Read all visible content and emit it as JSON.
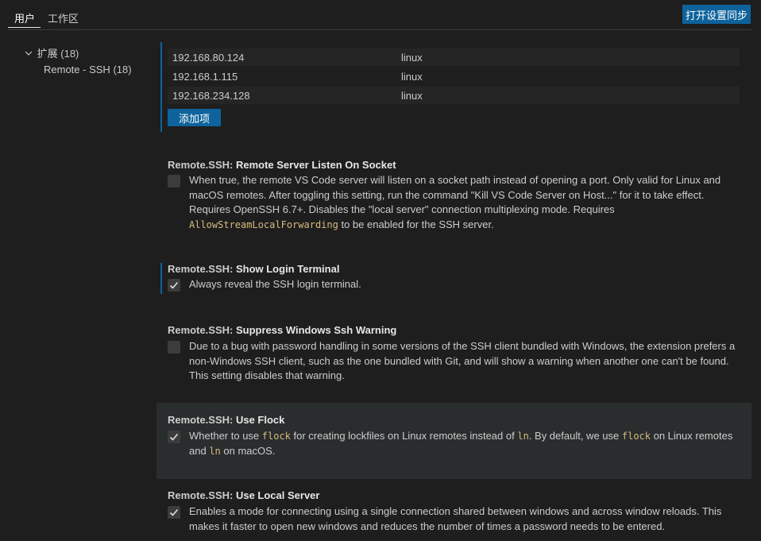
{
  "header": {
    "tabs": [
      {
        "label": "用户",
        "active": true
      },
      {
        "label": "工作区",
        "active": false
      }
    ],
    "sync_button": "打开设置同步"
  },
  "tree": {
    "extensions": {
      "label": "扩展",
      "count": "(18)"
    },
    "remote_ssh": {
      "label": "Remote - SSH",
      "count": "(18)"
    }
  },
  "hosts": {
    "rows": [
      {
        "host": "192.168.80.124",
        "platform": "linux"
      },
      {
        "host": "192.168.1.115",
        "platform": "linux"
      },
      {
        "host": "192.168.234.128",
        "platform": "linux"
      }
    ],
    "add_button": "添加项"
  },
  "settings": [
    {
      "prefix": "Remote.SSH: ",
      "name": "Remote Server Listen On Socket",
      "checked": false,
      "desc_a": "When true, the remote VS Code server will listen on a socket path instead of opening a port. Only valid for Linux and macOS remotes. After toggling this setting, run the command \"Kill VS Code Server on Host...\" for it to take effect. Requires OpenSSH 6.7+. Disables the \"local server\" connection multiplexing mode. Requires ",
      "code_a": "AllowStreamLocalForwarding",
      "desc_b": " to be enabled for the SSH server."
    },
    {
      "prefix": "Remote.SSH: ",
      "name": "Show Login Terminal",
      "checked": true,
      "desc_a": "Always reveal the SSH login terminal."
    },
    {
      "prefix": "Remote.SSH: ",
      "name": "Suppress Windows Ssh Warning",
      "checked": false,
      "desc_a": "Due to a bug with password handling in some versions of the SSH client bundled with Windows, the extension prefers a non-Windows SSH client, such as the one bundled with Git, and will show a warning when another one can't be found. This setting disables that warning."
    },
    {
      "prefix": "Remote.SSH: ",
      "name": "Use Flock",
      "checked": true,
      "desc_a": "Whether to use ",
      "code_a": "flock",
      "desc_b": " for creating lockfiles on Linux remotes instead of ",
      "code_b": "ln",
      "desc_c": ". By default, we use ",
      "code_c": "flock",
      "desc_d": " on Linux remotes and ",
      "code_d": "ln",
      "desc_e": " on macOS."
    },
    {
      "prefix": "Remote.SSH: ",
      "name": "Use Local Server",
      "checked": true,
      "desc_a": "Enables a mode for connecting using a single connection shared between windows and across window reloads. This makes it faster to open new windows and reduces the number of times a password needs to be entered."
    }
  ],
  "colors": {
    "background": "#1e1e1e",
    "accent_button": "#0e639c",
    "inline_code": "#d7ba7d",
    "focus_bar": "#0e639c"
  }
}
